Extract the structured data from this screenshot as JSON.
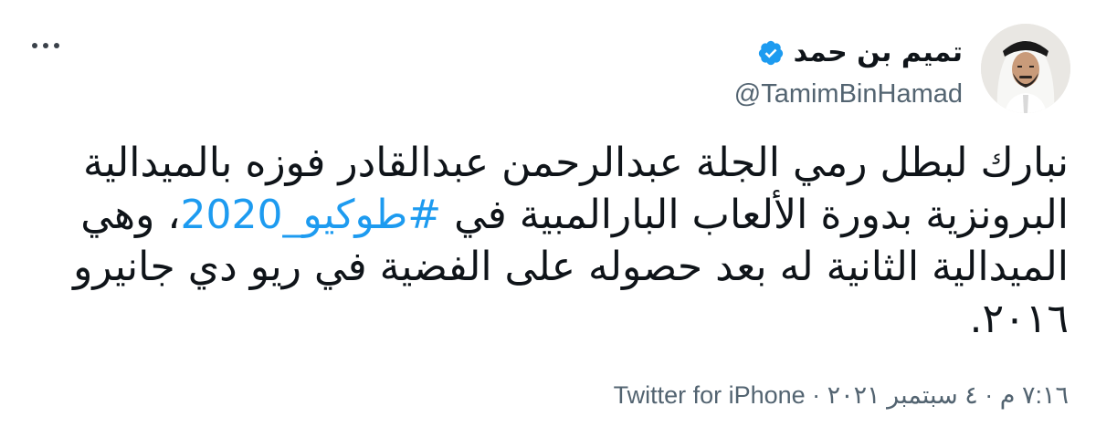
{
  "tweet": {
    "author": {
      "display_name": "تميم بن حمد",
      "handle": "@TamimBinHamad",
      "verified": true,
      "avatar_icon": "profile-photo"
    },
    "more_icon": "ellipsis-icon",
    "text": {
      "before": "نبارك لبطل رمي الجلة عبدالرحمن عبدالقادر فوزه بالميدالية البرونزية بدورة الألعاب البارالمبية في ",
      "hashtag": "#طوكيو_2020",
      "after": "، وهي الميدالية الثانية له بعد حصوله على الفضية في ريو دي جانيرو ٢٠١٦."
    },
    "meta": {
      "text": "٧:١٦ م · ٤ سبتمبر ٢٠٢١ · Twitter for iPhone"
    },
    "colors": {
      "hashtag": "#1d9bf0",
      "verified": "#1d9bf0",
      "secondary_text": "#536471",
      "primary_text": "#0f1419"
    }
  }
}
